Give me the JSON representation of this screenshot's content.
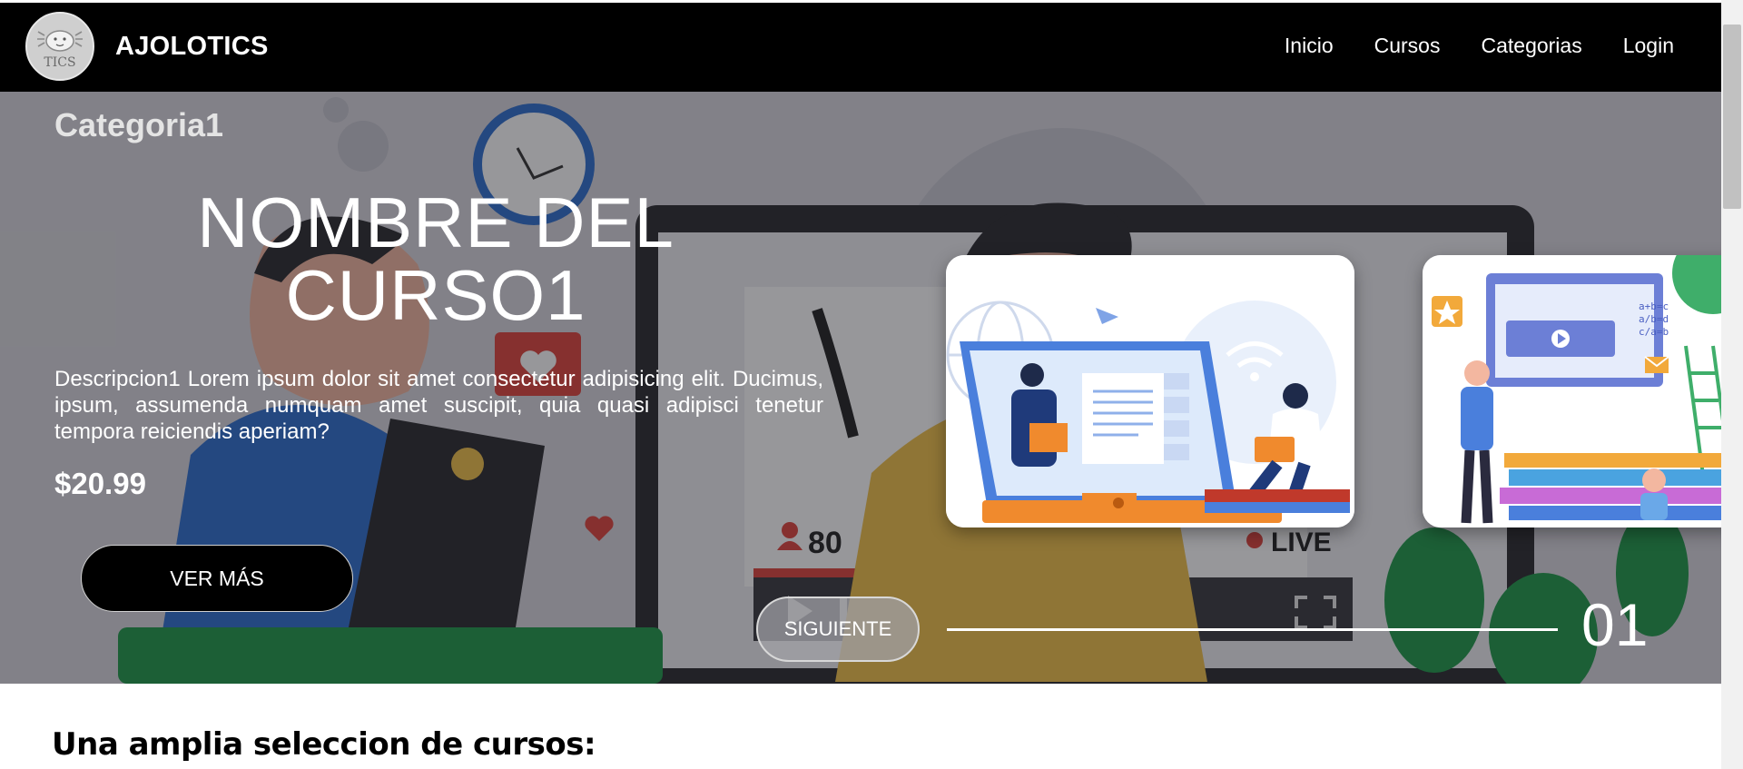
{
  "navbar": {
    "logo_text": "TICS",
    "brand": "AJOLOTICS",
    "links": [
      "Inicio",
      "Cursos",
      "Categorias",
      "Login"
    ]
  },
  "hero": {
    "category": "Categoria1",
    "title": "NOMBRE DEL CURSO1",
    "description": "Descripcion1 Lorem ipsum dolor sit amet consectetur adipisicing elit. Ducimus, ipsum, assumenda numquam amet suscipit, quia quasi adipisci tenetur tempora reiciendis aperiam?",
    "price": "$20.99",
    "more_button": "VER MÁS",
    "next_button": "SIGUIENTE",
    "counter": "01",
    "bg_labels": {
      "viewers": "80",
      "live": "LIVE"
    },
    "card2_formulas": [
      "a+b=c",
      "a/b=d",
      "c/a=b"
    ]
  },
  "section": {
    "title": "Una amplia seleccion de cursos:"
  },
  "colors": {
    "navbar": "#000000",
    "hero_overlay": "#6e6d72",
    "text_white": "#ffffff",
    "card_blue": "#3f6fd8",
    "card_orange": "#f08a2d"
  },
  "icons": [
    "axolotl-logo-icon",
    "user-icon",
    "live-dot-icon",
    "heart-icon",
    "fullscreen-icon",
    "play-icon",
    "pause-icon",
    "star-icon",
    "mail-icon"
  ]
}
